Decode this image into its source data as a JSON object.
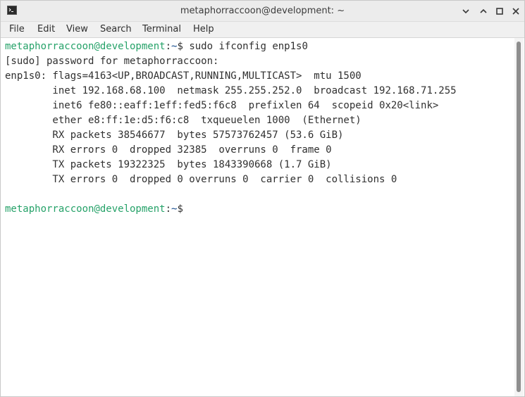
{
  "window": {
    "title": "metaphorraccoon@development: ~"
  },
  "menu": [
    "File",
    "Edit",
    "View",
    "Search",
    "Terminal",
    "Help"
  ],
  "terminal": {
    "prompt_user": "metaphorraccoon@development",
    "prompt_path": "~",
    "command": "sudo ifconfig enp1s0",
    "lines": [
      "[sudo] password for metaphorraccoon:",
      "enp1s0: flags=4163<UP,BROADCAST,RUNNING,MULTICAST>  mtu 1500",
      "        inet 192.168.68.100  netmask 255.255.252.0  broadcast 192.168.71.255",
      "        inet6 fe80::eaff:1eff:fed5:f6c8  prefixlen 64  scopeid 0x20<link>",
      "        ether e8:ff:1e:d5:f6:c8  txqueuelen 1000  (Ethernet)",
      "        RX packets 38546677  bytes 57573762457 (53.6 GiB)",
      "        RX errors 0  dropped 32385  overruns 0  frame 0",
      "        TX packets 19322325  bytes 1843390668 (1.7 GiB)",
      "        TX errors 0  dropped 0 overruns 0  carrier 0  collisions 0",
      ""
    ]
  },
  "icons": {
    "app": "terminal-icon",
    "minimize": "chevron-down-icon",
    "restore": "chevron-up-icon",
    "maximize": "maximize-square-icon",
    "close": "close-icon"
  },
  "colors": {
    "prompt_user": "#26a269",
    "prompt_path": "#12488b",
    "text": "#303030",
    "titlebar": "#ececec"
  }
}
